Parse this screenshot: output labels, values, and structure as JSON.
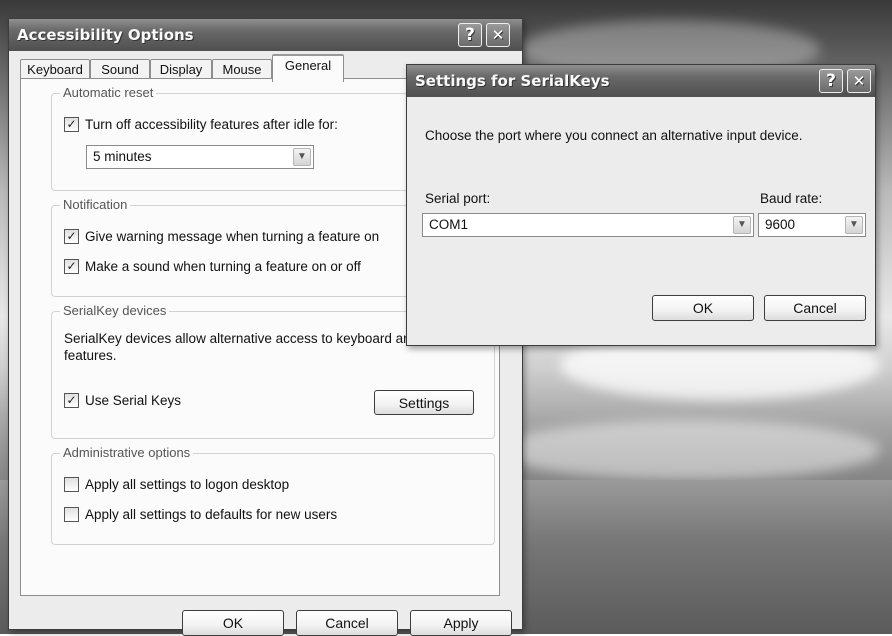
{
  "main_dialog": {
    "title": "Accessibility Options",
    "tabs": [
      "Keyboard",
      "Sound",
      "Display",
      "Mouse",
      "General"
    ],
    "active_tab": "General",
    "automatic_reset": {
      "group_title": "Automatic reset",
      "turn_off_label": "Turn off accessibility features after idle for:",
      "turn_off_checked": true,
      "idle_value": "5 minutes"
    },
    "notification": {
      "group_title": "Notification",
      "warning_label": "Give warning message when turning a feature on",
      "warning_checked": true,
      "sound_label": "Make a sound when turning a feature on or off",
      "sound_checked": true
    },
    "serialkey": {
      "group_title": "SerialKey devices",
      "description": "SerialKey devices allow alternative access to keyboard and mouse features.",
      "use_label": "Use Serial Keys",
      "use_checked": true,
      "settings_label": "Settings"
    },
    "administrative": {
      "group_title": "Administrative options",
      "logon_label": "Apply all settings to logon desktop",
      "logon_checked": false,
      "defaults_label": "Apply all settings to defaults for new users",
      "defaults_checked": false
    },
    "buttons": {
      "ok": "OK",
      "cancel": "Cancel",
      "apply": "Apply"
    }
  },
  "serial_dialog": {
    "title": "Settings for SerialKeys",
    "instruction": "Choose the port where you connect an alternative input device.",
    "serial_port_label": "Serial port:",
    "serial_port_value": "COM1",
    "baud_rate_label": "Baud rate:",
    "baud_rate_value": "9600",
    "buttons": {
      "ok": "OK",
      "cancel": "Cancel"
    }
  },
  "titlebar_buttons": {
    "help": "?",
    "close": "✕"
  },
  "check_glyph": "✓",
  "dropdown_glyph": "▼"
}
